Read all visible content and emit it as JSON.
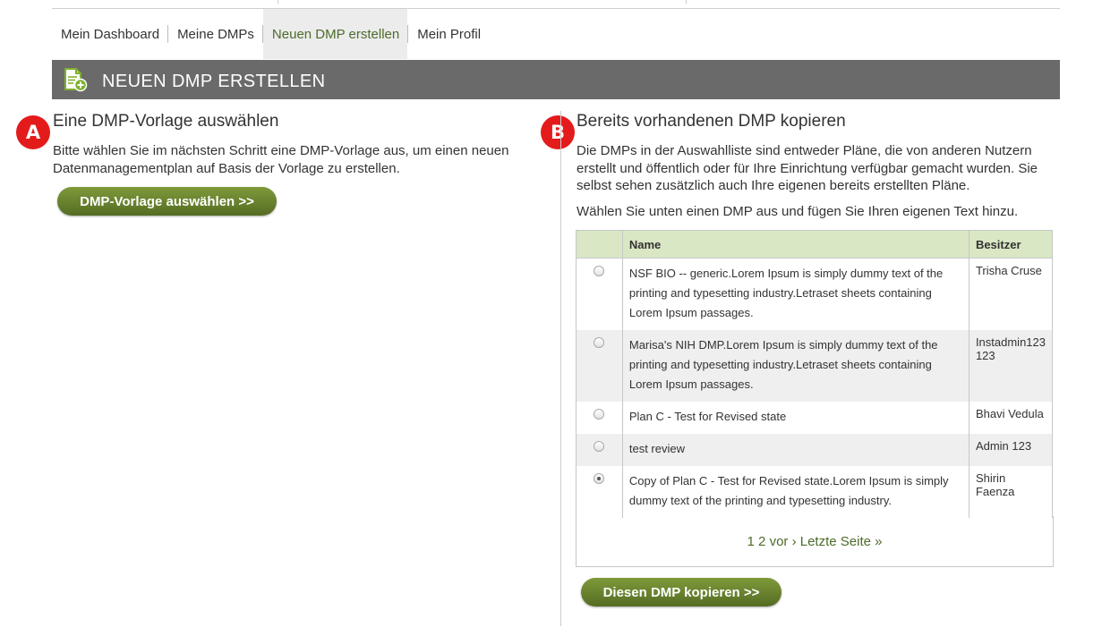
{
  "nav": {
    "items": [
      {
        "label": "Mein Dashboard",
        "active": false
      },
      {
        "label": "Meine DMPs",
        "active": false
      },
      {
        "label": "Neuen DMP erstellen",
        "active": true
      },
      {
        "label": "Mein Profil",
        "active": false
      }
    ]
  },
  "banner": {
    "title": "NEUEN DMP ERSTELLEN",
    "icon": "new-document-icon"
  },
  "markers": {
    "a": "A",
    "b": "B"
  },
  "left": {
    "title": "Eine DMP-Vorlage auswählen",
    "description": "Bitte wählen Sie im nächsten Schritt eine DMP-Vorlage aus, um einen neuen Datenmanagementplan auf Basis der Vorlage zu erstellen.",
    "button": "DMP-Vorlage auswählen >>"
  },
  "right": {
    "title": "Bereits vorhandenen DMP kopieren",
    "description": "Die DMPs in der Auswahlliste sind entweder Pläne, die von anderen Nutzern erstellt und öffentlich oder für Ihre Einrichtung verfügbar gemacht wurden. Sie selbst sehen zusätzlich auch Ihre eigenen bereits erstellten Pläne.",
    "instruction": "Wählen Sie unten einen DMP aus und fügen Sie Ihren eigenen Text hinzu.",
    "table": {
      "columns": [
        "",
        "Name",
        "Besitzer"
      ],
      "rows": [
        {
          "name": "NSF BIO -- generic.Lorem Ipsum is simply dummy text of the printing and typesetting industry.Letraset sheets containing Lorem Ipsum passages.",
          "owner": "Trisha Cruse",
          "selected": false
        },
        {
          "name": "Marisa's NIH DMP.Lorem Ipsum is simply dummy text of the printing and typesetting industry.Letraset sheets containing Lorem Ipsum passages.",
          "owner": "Instadmin123 123",
          "selected": false
        },
        {
          "name": "Plan C - Test for Revised state",
          "owner": "Bhavi Vedula",
          "selected": false
        },
        {
          "name": "test review",
          "owner": "Admin 123",
          "selected": false
        },
        {
          "name": "Copy of Plan C - Test for Revised state.Lorem Ipsum is simply dummy text of the printing and typesetting industry.",
          "owner": "Shirin Faenza",
          "selected": true
        }
      ]
    },
    "pagination": {
      "page1": "1",
      "page2": "2",
      "next": "vor ›",
      "last": "Letzte Seite »"
    },
    "button": "Diesen DMP kopieren >>"
  },
  "colors": {
    "accent_green": "#4d6b2a",
    "banner_gray": "#6a6a6a",
    "header_green": "#d9e7c5",
    "marker_red": "#e31b1b"
  }
}
